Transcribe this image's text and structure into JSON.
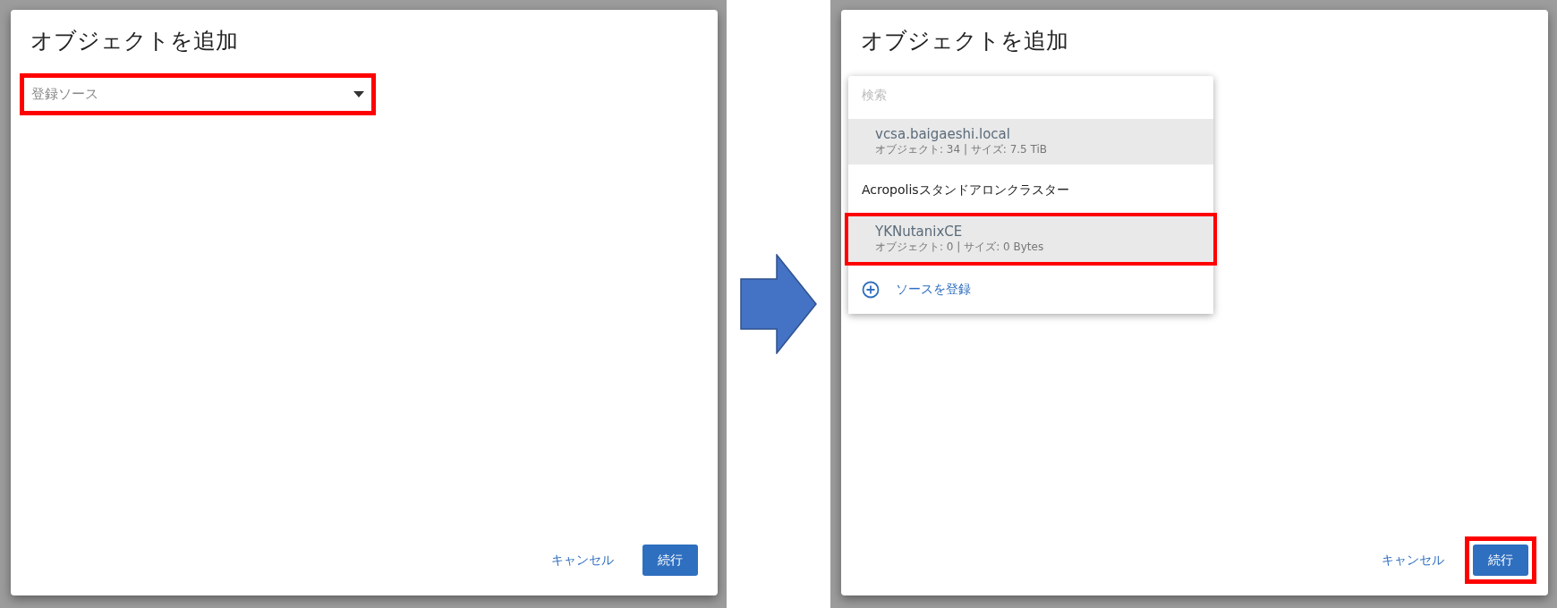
{
  "screens": [
    {
      "dialog": {
        "title": "オブジェクトを追加",
        "source_field": {
          "placeholder": "登録ソース",
          "open": false,
          "annotated": true
        },
        "buttons": [
          {
            "label": "キャンセル",
            "kind": "text",
            "annotated": false
          },
          {
            "label": "続行",
            "kind": "primary",
            "annotated": false
          }
        ]
      }
    },
    {
      "dialog": {
        "title": "オブジェクトを追加",
        "source_field": {
          "open": true
        },
        "dropdown": {
          "search_placeholder": "検索",
          "items": [
            {
              "kind": "source",
              "name": "vcsa.baigaeshi.local",
              "details": "オブジェクト: 34  |  サイズ: 7.5 TiB",
              "highlighted": true,
              "annotated": false
            },
            {
              "kind": "group",
              "label": "Acropolisスタンドアロンクラスター"
            },
            {
              "kind": "source",
              "name": "YKNutanixCE",
              "details": "オブジェクト: 0  |  サイズ: 0 Bytes",
              "highlighted": true,
              "annotated": true
            },
            {
              "kind": "action",
              "label": "ソースを登録"
            }
          ]
        },
        "buttons": [
          {
            "label": "キャンセル",
            "kind": "text",
            "annotated": false
          },
          {
            "label": "続行",
            "kind": "primary",
            "annotated": true
          }
        ]
      }
    }
  ]
}
